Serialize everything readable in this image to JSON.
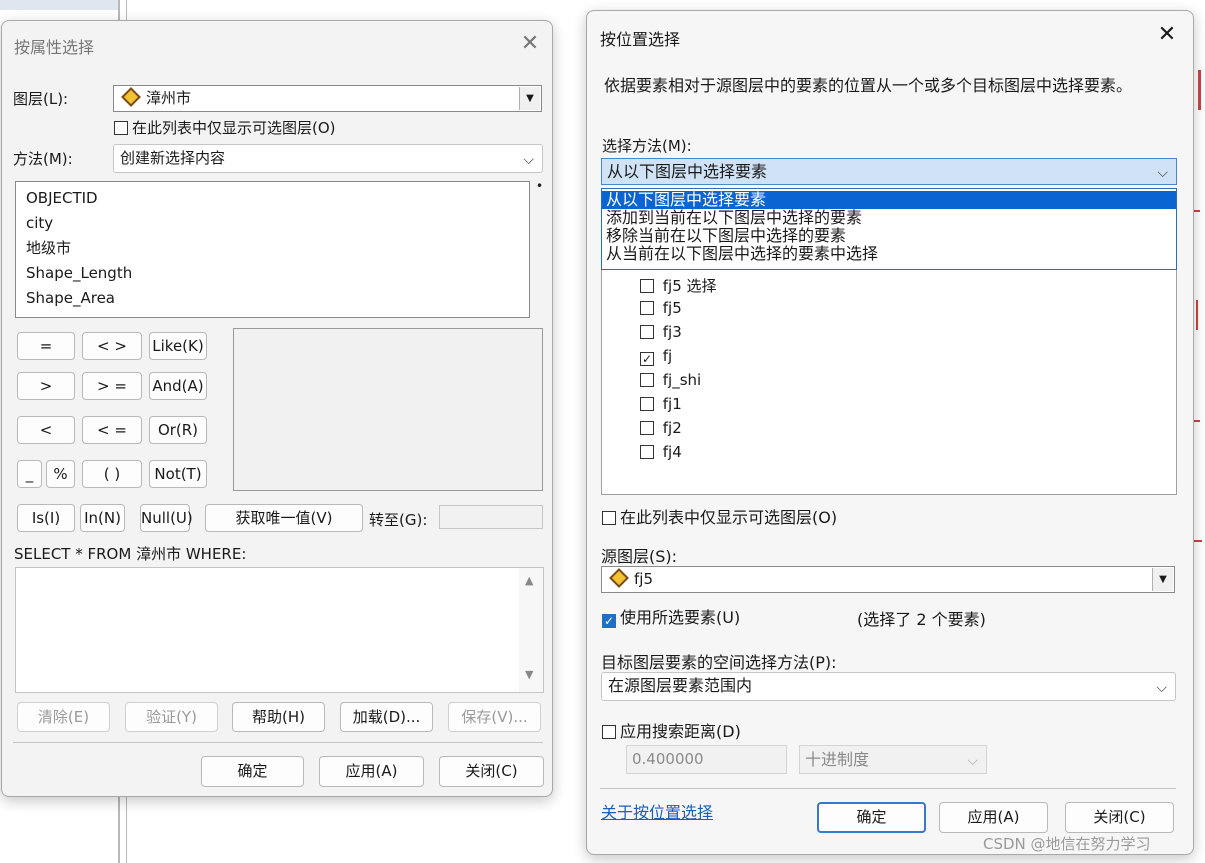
{
  "attr_dialog": {
    "title": "按属性选择",
    "layer_label": "图层(L):",
    "layer_value": "漳州市",
    "only_selectable_label": "在此列表中仅显示可选图层(O)",
    "method_label": "方法(M):",
    "method_value": "创建新选择内容",
    "fields": [
      "OBJECTID",
      "city",
      "地级市",
      "Shape_Length",
      "Shape_Area"
    ],
    "operators": {
      "eq": "=",
      "ne": "< >",
      "like": "Like(K)",
      "gt": ">",
      "ge": "> =",
      "and": "And(A)",
      "lt": "<",
      "le": "< =",
      "or": "Or(R)",
      "underscore": "_",
      "percent": "%",
      "parens": "( )",
      "not": "Not(T)",
      "is": "Is(I)",
      "in": "In(N)",
      "null": "Null(U)"
    },
    "unique_values_button": "获取唯一值(V)",
    "goto_label": "转至(G):",
    "sql_prefix": "SELECT * FROM 漳州市 WHERE:",
    "buttons": {
      "clear": "清除(E)",
      "verify": "验证(Y)",
      "help": "帮助(H)",
      "load": "加载(D)...",
      "save": "保存(V)...",
      "ok": "确定",
      "apply": "应用(A)",
      "close": "关闭(C)"
    }
  },
  "loc_dialog": {
    "title": "按位置选择",
    "description": "依据要素相对于源图层中的要素的位置从一个或多个目标图层中选择要素。",
    "method_label": "选择方法(M):",
    "method_value": "从以下图层中选择要素",
    "method_options": [
      "从以下图层中选择要素",
      "添加到当前在以下图层中选择的要素",
      "移除当前在以下图层中选择的要素",
      "从当前在以下图层中选择的要素中选择"
    ],
    "target_layers": [
      {
        "name": "fj5 选择",
        "checked": false
      },
      {
        "name": "fj5",
        "checked": false
      },
      {
        "name": "fj3",
        "checked": false
      },
      {
        "name": "fj",
        "checked": true
      },
      {
        "name": "fj_shi",
        "checked": false
      },
      {
        "name": "fj1",
        "checked": false
      },
      {
        "name": "fj2",
        "checked": false
      },
      {
        "name": "fj4",
        "checked": false
      }
    ],
    "only_selectable_label": "在此列表中仅显示可选图层(O)",
    "source_label": "源图层(S):",
    "source_value": "fj5",
    "use_selected_label": "使用所选要素(U)",
    "selected_count_text": "(选择了 2 个要素)",
    "spatial_method_label": "目标图层要素的空间选择方法(P):",
    "spatial_method_value": "在源图层要素范围内",
    "search_distance_label": "应用搜索距离(D)",
    "distance_value": "0.400000",
    "distance_unit": "十进制度",
    "about_link": "关于按位置选择",
    "buttons": {
      "ok": "确定",
      "apply": "应用(A)",
      "close": "关闭(C)"
    }
  },
  "watermark": "CSDN @地信在努力学习",
  "colors": {
    "accent": "#0a64d2",
    "link": "#1c5fb8",
    "dialog_bg": "#f3f3f3"
  },
  "icons": {
    "close": "close-icon",
    "layer": "layer-diamond-icon",
    "dropdown": "chevron-down-icon"
  }
}
